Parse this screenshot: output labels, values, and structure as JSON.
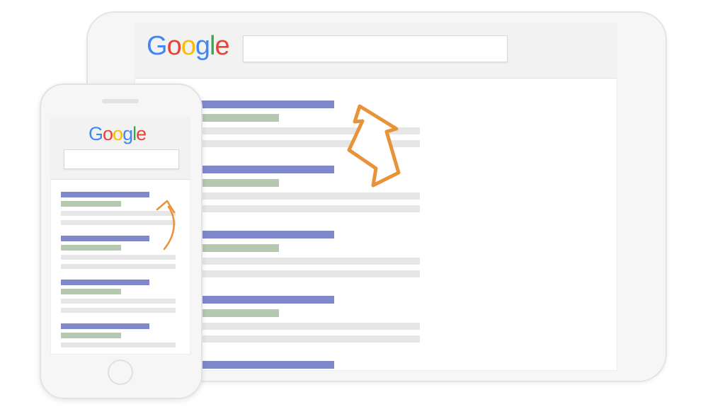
{
  "logo": {
    "letters": [
      {
        "char": "G",
        "color": "#4285F4"
      },
      {
        "char": "o",
        "color": "#EA4335"
      },
      {
        "char": "o",
        "color": "#FBBC05"
      },
      {
        "char": "g",
        "color": "#4285F4"
      },
      {
        "char": "l",
        "color": "#34A853"
      },
      {
        "char": "e",
        "color": "#EA4335"
      }
    ]
  },
  "colors": {
    "result_title": "#8088cc",
    "result_url": "#b5c8b0",
    "result_description": "#e6e6e6",
    "arrow": "#E8923A"
  },
  "tablet": {
    "search_value": "",
    "results": [
      {
        "title_lines": 1,
        "url_lines": 1,
        "description_lines": 2
      },
      {
        "title_lines": 1,
        "url_lines": 1,
        "description_lines": 2
      },
      {
        "title_lines": 1,
        "url_lines": 1,
        "description_lines": 2
      },
      {
        "title_lines": 1,
        "url_lines": 1,
        "description_lines": 2
      },
      {
        "title_lines": 1,
        "url_lines": 0,
        "description_lines": 0
      }
    ]
  },
  "phone": {
    "search_value": "",
    "results": [
      {
        "title_lines": 1,
        "url_lines": 1,
        "description_lines": 2
      },
      {
        "title_lines": 1,
        "url_lines": 1,
        "description_lines": 2
      },
      {
        "title_lines": 1,
        "url_lines": 1,
        "description_lines": 2
      },
      {
        "title_lines": 1,
        "url_lines": 1,
        "description_lines": 1
      }
    ]
  },
  "icons": {
    "tablet_arrow": "up-arrow-icon",
    "phone_arrow": "curved-up-arrow-icon",
    "home_button": "home-button-icon"
  }
}
